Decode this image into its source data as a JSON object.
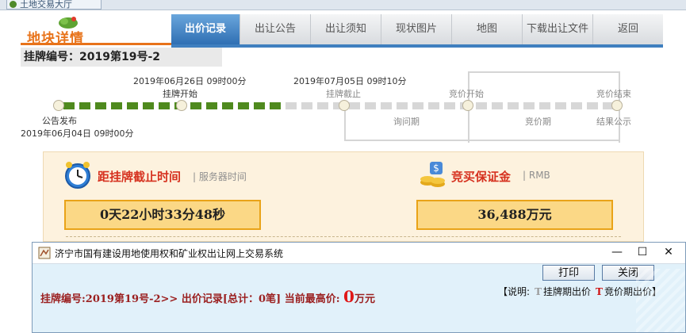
{
  "browser_tab": {
    "label": "土地交易大厅"
  },
  "header": {
    "title": "地块详情",
    "tabs": [
      {
        "label": "出价记录",
        "active": true
      },
      {
        "label": "出让公告",
        "active": false
      },
      {
        "label": "出让须知",
        "active": false
      },
      {
        "label": "现状图片",
        "active": false
      },
      {
        "label": "地图",
        "active": false
      },
      {
        "label": "下载出让文件",
        "active": false
      },
      {
        "label": "返回",
        "active": false
      }
    ],
    "listing_number": "挂牌编号：2019第19号-2"
  },
  "timeline": {
    "listing_start": {
      "datetime": "2019年06月26日 09时00分",
      "label": "挂牌开始"
    },
    "listing_end": {
      "datetime": "2019年07月05日 09时10分",
      "label": "挂牌截止"
    },
    "bid_start": {
      "label": "竞价开始"
    },
    "bid_end": {
      "label": "竞价结束"
    },
    "announce": {
      "label": "公告发布",
      "datetime": "2019年06月04日 09时00分"
    },
    "inquiry_period": "询问期",
    "bidding_period": "竞价期",
    "result_notice": "结果公示",
    "progress_segments_done": 14,
    "progress_segments_total": 35
  },
  "countdown": {
    "title": "距挂牌截止时间",
    "subtitle": "| 服务器时间",
    "value": "0天22小时33分48秒"
  },
  "deposit": {
    "title": "竞买保证金",
    "subtitle": "| RMB",
    "value": "36,488万元"
  },
  "popup": {
    "title": "济宁市国有建设用地使用权和矿业权出让网上交易系统",
    "minimize": "—",
    "maximize": "☐",
    "close": "✕",
    "print_label": "打印",
    "close_label": "关闭",
    "headline_prefix": "挂牌编号:2019第19号-2>> 出价记录[总计：0笔] 当前最高价: ",
    "highest_price": "0",
    "price_unit": "万元",
    "legend_open": "【说明:",
    "legend_t1": "T",
    "legend_t1_label": "挂牌期出价",
    "legend_t2": "T",
    "legend_t2_label": "竞价期出价】"
  },
  "colors": {
    "accent_orange": "#e8731a",
    "tab_blue": "#2f6fb3",
    "progress_green": "#4f8a1e",
    "alert_red": "#d6311f"
  }
}
